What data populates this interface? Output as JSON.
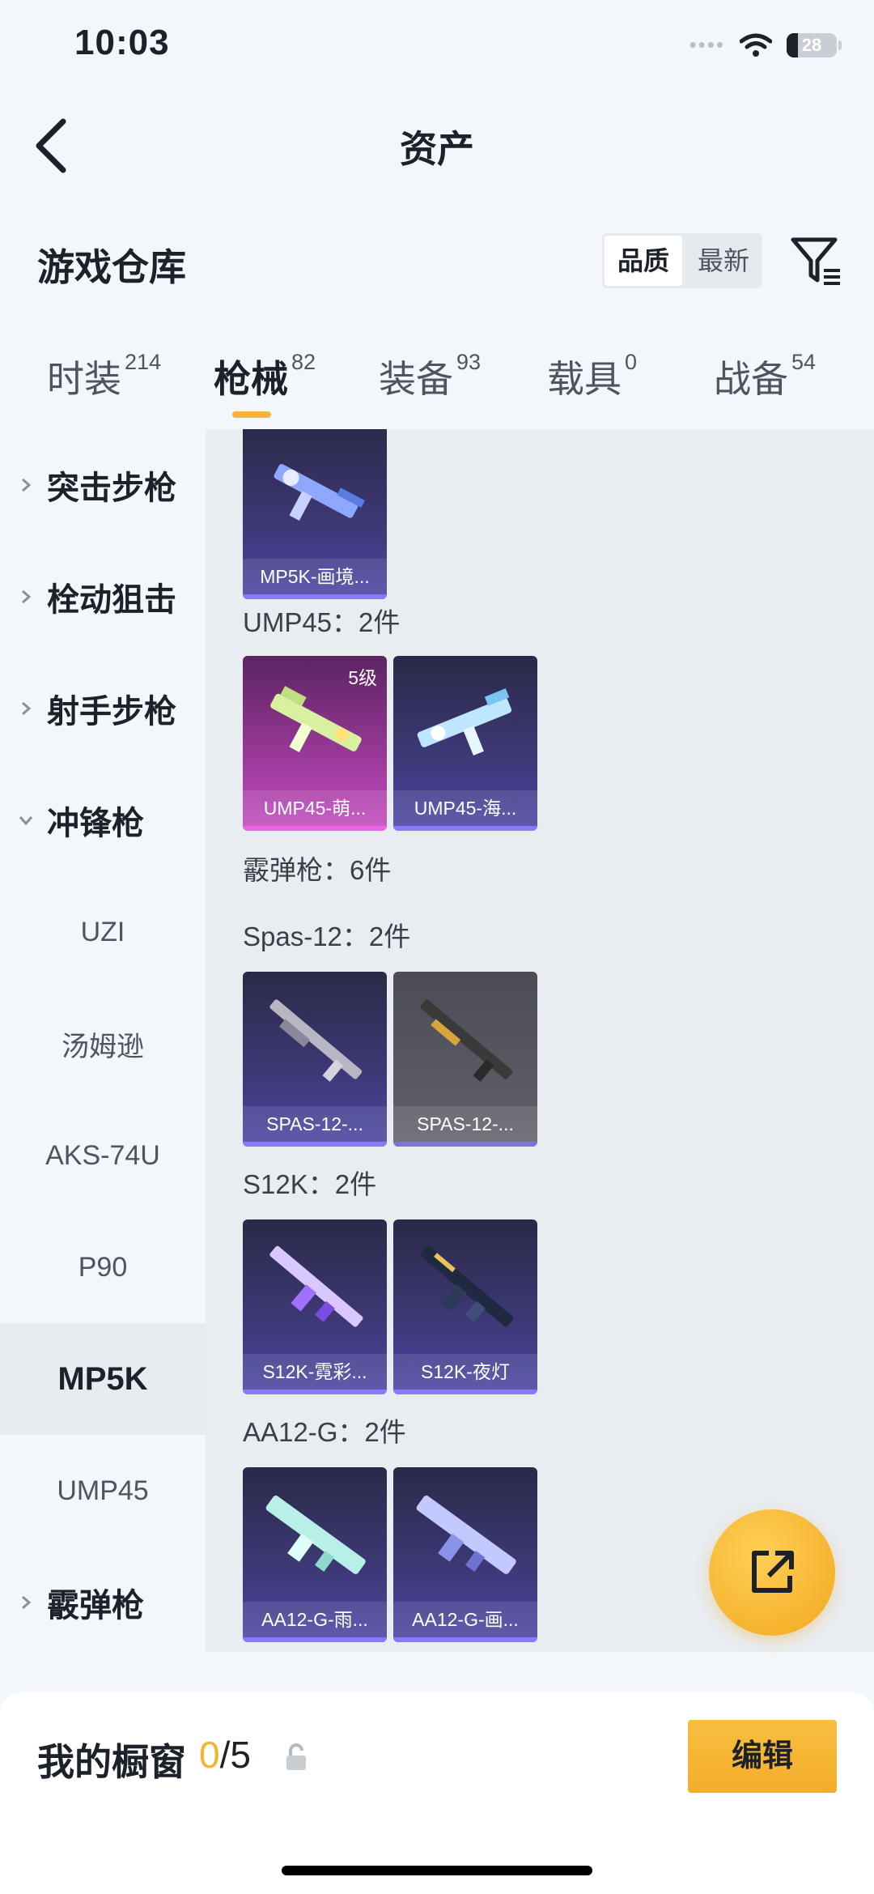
{
  "status_bar": {
    "time": "10:03",
    "battery": "28",
    "signal_dots": "••••"
  },
  "nav": {
    "title": "资产"
  },
  "warehouse": {
    "title": "游戏仓库",
    "sort_options": [
      "品质",
      "最新"
    ],
    "sort_selected": "品质"
  },
  "tabs": [
    {
      "label": "时装",
      "count": "214"
    },
    {
      "label": "枪械",
      "count": "82"
    },
    {
      "label": "装备",
      "count": "93"
    },
    {
      "label": "载具",
      "count": "0"
    },
    {
      "label": "战备",
      "count": "54"
    }
  ],
  "active_tab": "枪械",
  "sidebar": {
    "categories": [
      "突击步枪",
      "栓动狙击",
      "射手步枪",
      "冲锋枪",
      "霰弹枪"
    ],
    "subitems": [
      "UZI",
      "汤姆逊",
      "AKS-74U",
      "P90",
      "MP5K",
      "UMP45"
    ],
    "selected_subitem": "MP5K"
  },
  "content": {
    "groups": [
      {
        "title": "UMP45：2件"
      },
      {
        "title": "霰弹枪：6件"
      },
      {
        "title": "Spas-12：2件"
      },
      {
        "title": "S12K：2件"
      },
      {
        "title": "AA12-G：2件"
      }
    ],
    "cards": [
      {
        "name": "MP5K-画境...",
        "level": ""
      },
      {
        "name": "UMP45-萌...",
        "level": "5级"
      },
      {
        "name": "UMP45-海..."
      },
      {
        "name": "SPAS-12-..."
      },
      {
        "name": "SPAS-12-..."
      },
      {
        "name": "S12K-霓彩..."
      },
      {
        "name": "S12K-夜灯"
      },
      {
        "name": "AA12-G-雨..."
      },
      {
        "name": "AA12-G-画..."
      }
    ]
  },
  "showcase": {
    "title": "我的橱窗",
    "current": "0",
    "total": "/5",
    "edit_label": "编辑"
  },
  "colors": {
    "accent": "#f5b32e",
    "card_purple": "#3e3a7a",
    "card_pink": "#9c3a9b"
  }
}
